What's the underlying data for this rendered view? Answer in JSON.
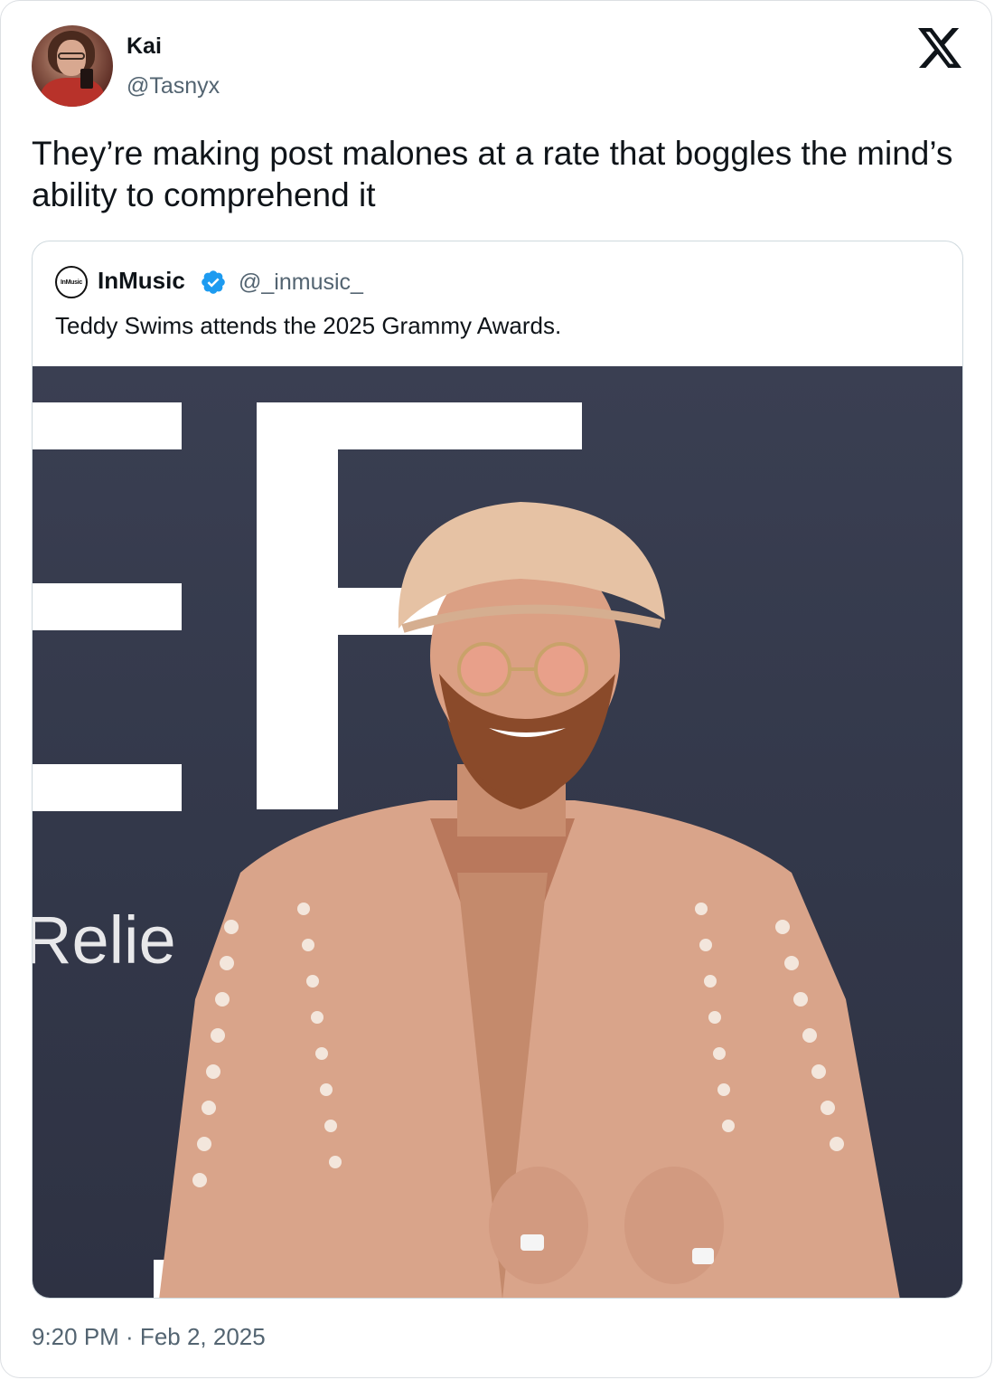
{
  "tweet": {
    "author": {
      "name": "Kai",
      "handle": "@Tasnyx",
      "avatar_icon": "user-avatar-photo"
    },
    "text": "They’re making post malones at a rate that boggles the mind’s ability to comprehend it",
    "timestamp": "9:20 PM · Feb 2, 2025",
    "platform_icon": "x-logo-icon"
  },
  "quoted_tweet": {
    "author": {
      "name": "InMusic",
      "handle": "@_inmusic_",
      "avatar_text": "InMusic",
      "verified": true
    },
    "text": "Teddy Swims attends the 2025 Grammy Awards.",
    "image": {
      "backdrop_letters": "EF",
      "backdrop_word": "Relie",
      "backdrop_bottom": "MI"
    }
  },
  "colors": {
    "text_primary": "#0f1419",
    "text_secondary": "#536471",
    "border": "#cfd9de",
    "verified_blue": "#1d9bf0",
    "photo_backdrop": "#33384a"
  }
}
